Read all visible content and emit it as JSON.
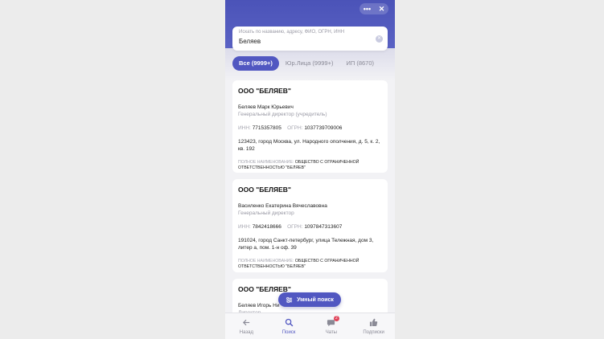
{
  "controls": {
    "more": "•••",
    "close": "✕"
  },
  "search": {
    "placeholder": "Искать по названию, адресу, ФИО, ОГРН, ИНН",
    "value": "Беляев"
  },
  "tabs": [
    {
      "label": "Все (9999+)",
      "active": true
    },
    {
      "label": "Юр.Лица (9999+)",
      "active": false
    },
    {
      "label": "ИП (8670)",
      "active": false
    }
  ],
  "cards": [
    {
      "title": "ООО \"БЕЛЯЕВ\"",
      "person": "Беляев Марк Юрьевич",
      "role": "Генеральный директор (учредитель)",
      "inn_label": "ИНН:",
      "inn": "7715357805",
      "ogrn_label": "ОГРН:",
      "ogrn": "1037739709006",
      "address": "123423, город Москва, ул. Народного ополчения, д. 5, к. 2, кв. 192",
      "full_label": "ПОЛНОЕ НАИМЕНОВАНИЕ:",
      "full_name": "ОБЩЕСТВО С ОГРАНИЧЕННОЙ ОТВЕТСТВЕННОСТЬЮ \"БЕЛЯЕВ\""
    },
    {
      "title": "ООО \"БЕЛЯЕВ\"",
      "person": "Василенко Екатерина Вячеславовна",
      "role": "Генеральный директор",
      "inn_label": "ИНН:",
      "inn": "7842418666",
      "ogrn_label": "ОГРН:",
      "ogrn": "1097847313607",
      "address": "191024, город Санкт-петербург, улица Тележная, дом 3, литер а, пом. 1-н оф. 39",
      "full_label": "ПОЛНОЕ НАИМЕНОВАНИЕ:",
      "full_name": "ОБЩЕСТВО С ОГРАНИЧЕННОЙ ОТВЕТСТВЕННОСТЬЮ \"БЕЛЯЕВ\""
    },
    {
      "title": "ООО \"БЕЛЯЕВ\"",
      "person": "Беляев Игорь Ни",
      "role": "Директор"
    }
  ],
  "smart_search": {
    "label": "Умный поиск"
  },
  "tabbar": [
    {
      "label": "Назад",
      "icon": "arrow-left-icon"
    },
    {
      "label": "Поиск",
      "icon": "search-icon",
      "active": true
    },
    {
      "label": "Чаты",
      "icon": "chat-icon",
      "badge": "2"
    },
    {
      "label": "Подписки",
      "icon": "thumbs-up-icon"
    }
  ],
  "colors": {
    "accent": "#5157c1",
    "header": "#4b53b8",
    "badge": "#e0445a"
  }
}
